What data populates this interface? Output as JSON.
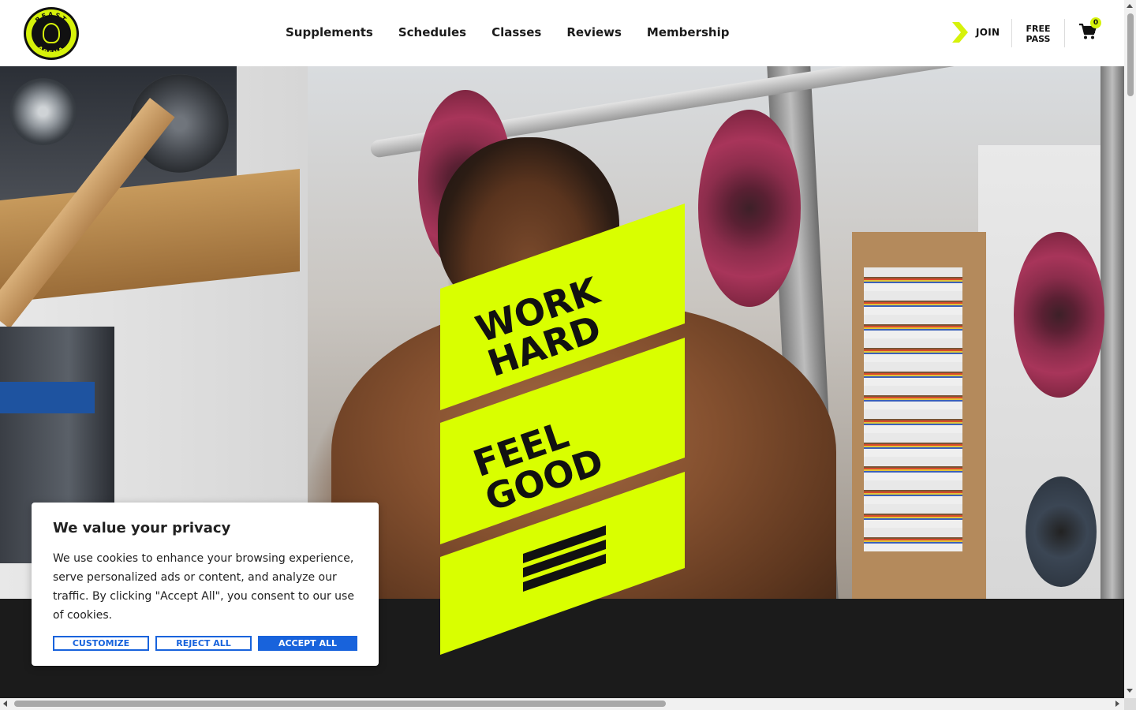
{
  "header": {
    "logo_alt": "Beast Arena",
    "logo_ring_top": "BEAST",
    "logo_ring_bottom": "ARENA",
    "nav": [
      "Supplements",
      "Schedules",
      "Classes",
      "Reviews",
      "Membership"
    ],
    "join_label": "JOIN",
    "free_pass_line1": "FREE",
    "free_pass_line2": "PASS",
    "cart_count": "0",
    "icons": {
      "join": "chevron-right-icon",
      "cart": "cart-icon"
    },
    "accent_color": "#d6f20a"
  },
  "hero": {
    "slogan_line1": "WORK",
    "slogan_line2": "HARD",
    "slogan_line3": "FEEL",
    "slogan_line4": "GOOD",
    "accent_color": "#d9ff00",
    "icons": {
      "stripes": "stripes-icon"
    }
  },
  "cookie": {
    "title": "We value your privacy",
    "text": "We use cookies to enhance your browsing experience, serve personalized ads or content, and analyze our traffic. By clicking \"Accept All\", you consent to our use of cookies.",
    "customize_label": "CUSTOMIZE",
    "reject_label": "REJECT ALL",
    "accept_label": "ACCEPT ALL",
    "button_color": "#1863dc"
  }
}
